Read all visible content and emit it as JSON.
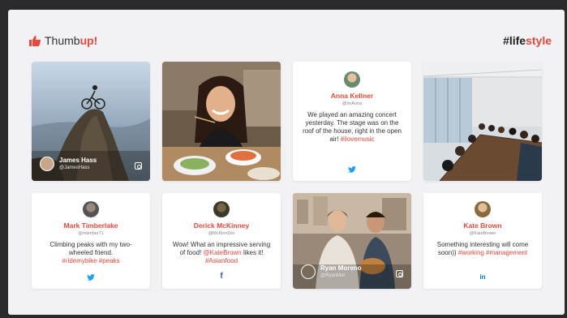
{
  "logo": {
    "pre": "Thumb",
    "accent": "up!"
  },
  "hashtag": {
    "pre": "#life",
    "accent": "style"
  },
  "cards": {
    "james": {
      "name": "James Hass",
      "handle": "@JamesHass"
    },
    "mark": {
      "name": "Mark Timberlake",
      "handle": "@mtimber71",
      "text": "Climbing peaks with my two-wheeled friend.",
      "tags": "#ridemybike #peaks",
      "social": "twitter-icon"
    },
    "derick": {
      "name": "Derick McKinney",
      "handle": "@McKinnDer",
      "text": "Wow! What an impressive serving of food!",
      "mention": "@KateBrown",
      "text2": "likes it!",
      "tags": "#Asianfood",
      "social": "facebook-icon"
    },
    "anna": {
      "name": "Anna Kellner",
      "handle": "@imAnna",
      "text": "We played an amazing concert yesterday. The stage was on the roof of the house, right in the open air!",
      "tags": "#ilovemusic",
      "social": "twitter-icon"
    },
    "ryan": {
      "name": "Ryan Moreno",
      "handle": "@RyanMor"
    },
    "kate": {
      "name": "Kate Brown",
      "handle": "@KateBrown",
      "text": "Something interesting will come soon))",
      "tags": "#working #management",
      "social": "linkedin-icon"
    }
  },
  "social_glyphs": {
    "twitter": "ὂ6",
    "facebook": "f",
    "linkedin": "in"
  },
  "colors": {
    "accent": "#e8473c",
    "twitter": "#1da1f2",
    "facebook": "#3b5998",
    "linkedin": "#0077b5"
  }
}
